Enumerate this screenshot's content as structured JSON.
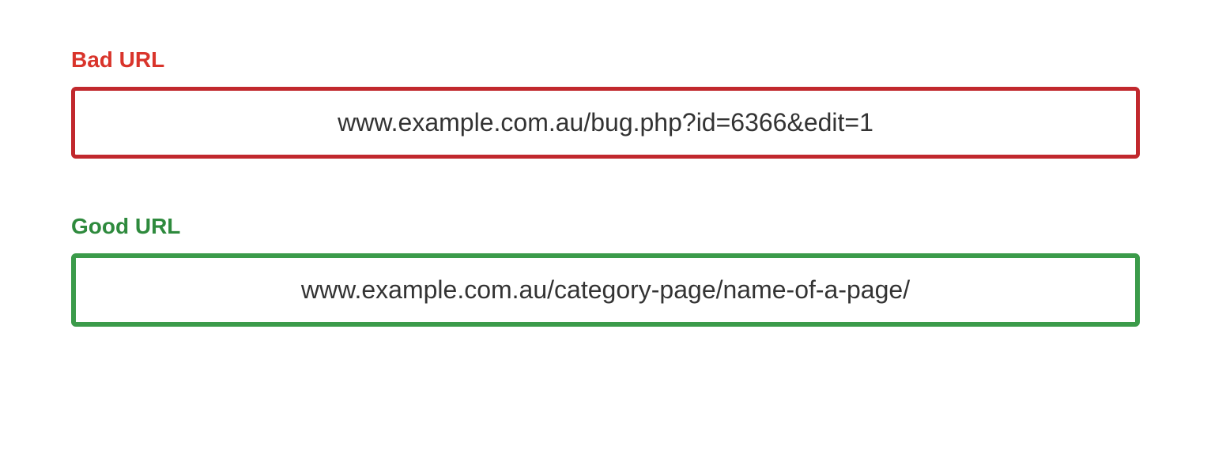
{
  "bad": {
    "label": "Bad URL",
    "url": "www.example.com.au/bug.php?id=6366&edit=1",
    "label_color": "#d9342b",
    "border_color": "#c1282d"
  },
  "good": {
    "label": "Good URL",
    "url": "www.example.com.au/category-page/name-of-a-page/",
    "label_color": "#2e8a3d",
    "border_color": "#3b9b4a"
  }
}
